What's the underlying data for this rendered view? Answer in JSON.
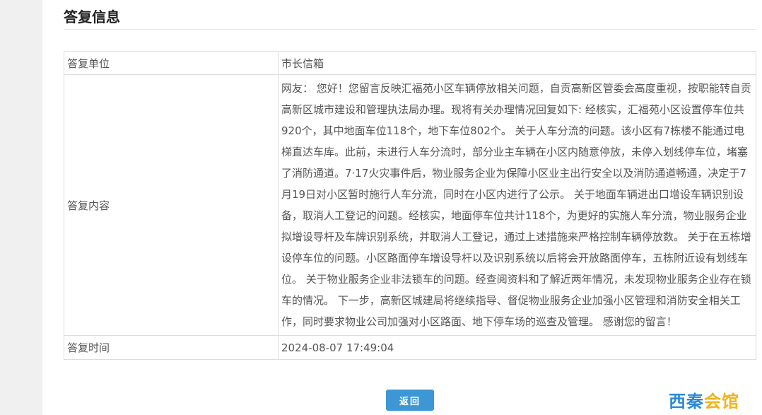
{
  "section": {
    "title": "答复信息"
  },
  "reply": {
    "unit_label": "答复单位",
    "unit_value": "市长信箱",
    "content_label": "答复内容",
    "content_value": "网友： 您好！您留言反映汇福苑小区车辆停放相关问题，自贡高新区管委会高度重视，按职能转自贡高新区城市建设和管理执法局办理。现将有关办理情况回复如下: 经核实，汇福苑小区设置停车位共920个，其中地面车位118个，地下车位802个。 关于人车分流的问题。该小区有7栋楼不能通过电梯直达车库。此前，未进行人车分流时，部分业主车辆在小区内随意停放，未停入划线停车位，堵塞了消防通道。7·17火灾事件后，物业服务企业为保障小区业主出行安全以及消防通道畅通，决定于7月19日对小区暂时施行人车分流，同时在小区内进行了公示。 关于地面车辆进出口增设车辆识别设备，取消人工登记的问题。经核实，地面停车位共计118个，为更好的实施人车分流，物业服务企业拟增设导杆及车牌识别系统，并取消人工登记，通过上述措施来严格控制车辆停放数。 关于在五栋增设停车位的问题。小区路面停车增设导杆以及识别系统以后将会开放路面停车，五栋附近设有划线车位。 关于物业服务企业非法锁车的问题。经查阅资料和了解近两年情况，未发现物业服务企业存在锁车的情况。 下一步，高新区城建局将继续指导、督促物业服务企业加强小区管理和消防安全相关工作，同时要求物业公司加强对小区路面、地下停车场的巡查及管理。 感谢您的留言！",
    "time_label": "答复时间",
    "time_value": "2024-08-07 17:49:04"
  },
  "buttons": {
    "back_label": "返回"
  },
  "watermark": {
    "part1": "西秦",
    "part2": "会馆"
  }
}
